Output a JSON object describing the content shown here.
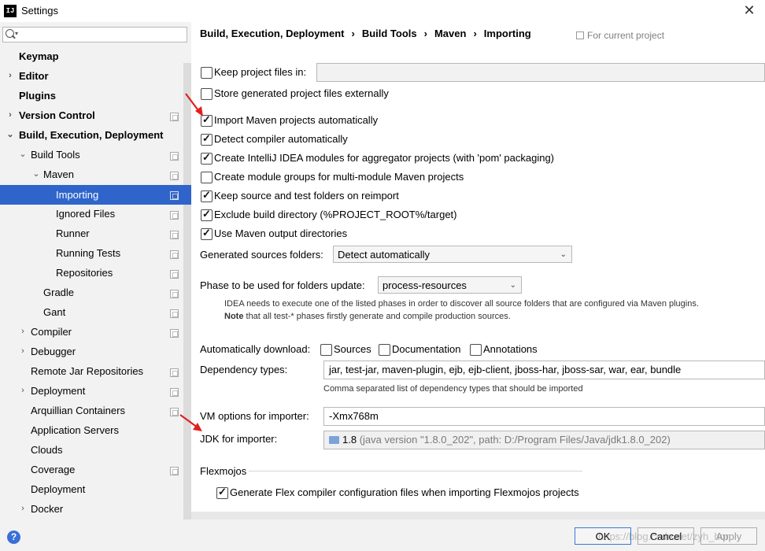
{
  "window": {
    "title": "Settings",
    "app_icon": "IJ"
  },
  "sidebar": {
    "items": [
      {
        "label": "Keymap"
      },
      {
        "label": "Editor"
      },
      {
        "label": "Plugins"
      },
      {
        "label": "Version Control"
      },
      {
        "label": "Build, Execution, Deployment"
      },
      {
        "label": "Build Tools"
      },
      {
        "label": "Maven"
      },
      {
        "label": "Importing"
      },
      {
        "label": "Ignored Files"
      },
      {
        "label": "Runner"
      },
      {
        "label": "Running Tests"
      },
      {
        "label": "Repositories"
      },
      {
        "label": "Gradle"
      },
      {
        "label": "Gant"
      },
      {
        "label": "Compiler"
      },
      {
        "label": "Debugger"
      },
      {
        "label": "Remote Jar Repositories"
      },
      {
        "label": "Deployment"
      },
      {
        "label": "Arquillian Containers"
      },
      {
        "label": "Application Servers"
      },
      {
        "label": "Clouds"
      },
      {
        "label": "Coverage"
      },
      {
        "label": "Deployment"
      },
      {
        "label": "Docker"
      }
    ]
  },
  "breadcrumb": [
    "Build, Execution, Deployment",
    "Build Tools",
    "Maven",
    "Importing"
  ],
  "breadcrumb_sep": "›",
  "for_project": "For current project",
  "options": {
    "keep_project_files": {
      "label": "Keep project files in:",
      "checked": false
    },
    "store_generated": {
      "label": "Store generated project files externally",
      "checked": false
    },
    "import_auto": {
      "label": "Import Maven projects automatically",
      "checked": true
    },
    "detect_compiler": {
      "label": "Detect compiler automatically",
      "checked": true
    },
    "create_modules": {
      "label": "Create IntelliJ IDEA modules for aggregator projects (with 'pom' packaging)",
      "checked": true
    },
    "create_groups": {
      "label": "Create module groups for multi-module Maven projects",
      "checked": false
    },
    "keep_source": {
      "label": "Keep source and test folders on reimport",
      "checked": true
    },
    "exclude_build": {
      "label": "Exclude build directory (%PROJECT_ROOT%/target)",
      "checked": true
    },
    "use_output": {
      "label": "Use Maven output directories",
      "checked": true
    }
  },
  "generated_sources": {
    "label": "Generated sources folders:",
    "value": "Detect automatically"
  },
  "phase": {
    "label": "Phase to be used for folders update:",
    "value": "process-resources"
  },
  "phase_hint": {
    "line1": "IDEA needs to execute one of the listed phases in order to discover all source folders that are configured via Maven plugins.",
    "note_bold": "Note",
    "line2": " that all test-* phases firstly generate and compile production sources."
  },
  "auto_download": {
    "label": "Automatically download:",
    "sources": {
      "label": "Sources",
      "checked": false
    },
    "documentation": {
      "label": "Documentation",
      "checked": false
    },
    "annotations": {
      "label": "Annotations",
      "checked": false
    }
  },
  "dependency_types": {
    "label": "Dependency types:",
    "value": "jar, test-jar, maven-plugin, ejb, ejb-client, jboss-har, jboss-sar, war, ear, bundle",
    "hint": "Comma separated list of dependency types that should be imported"
  },
  "vm_options": {
    "label": "VM options for importer:",
    "value": "-Xmx768m"
  },
  "jdk": {
    "label": "JDK for importer:",
    "version": "1.8",
    "detail": " (java version \"1.8.0_202\", path: D:/Program Files/Java/jdk1.8.0_202)"
  },
  "flexmojos": {
    "section": "Flexmojos",
    "generate": {
      "label": "Generate Flex compiler configuration files when importing Flexmojos projects",
      "checked": true
    }
  },
  "buttons": {
    "ok": "OK",
    "cancel": "Cancel",
    "apply": "Apply",
    "help": "?"
  },
  "watermark": "https://blog.csdn.net/zyh_hor",
  "colors": {
    "selection": "#2f65ca",
    "arrow": "#e02020",
    "help": "#3a6fd8"
  }
}
